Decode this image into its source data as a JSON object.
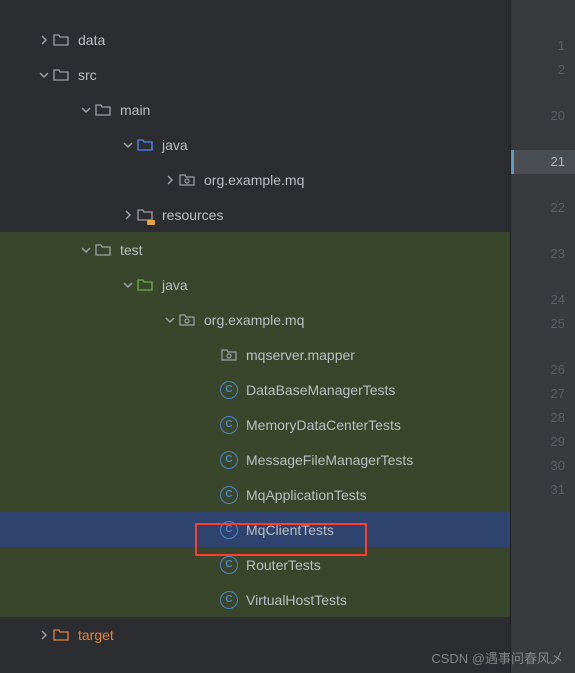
{
  "tree": {
    "data": "data",
    "src": "src",
    "main": "main",
    "main_java": "java",
    "main_pkg": "org.example.mq",
    "resources": "resources",
    "test": "test",
    "test_java": "java",
    "test_pkg": "org.example.mq",
    "pkg_mapper": "mqserver.mapper",
    "c_database": "DataBaseManagerTests",
    "c_memory": "MemoryDataCenterTests",
    "c_message": "MessageFileManagerTests",
    "c_app": "MqApplicationTests",
    "c_client": "MqClientTests",
    "c_router": "RouterTests",
    "c_vhost": "VirtualHostTests",
    "target": "target"
  },
  "gutter": {
    "lines": [
      "1",
      "2",
      "",
      "20",
      "",
      "21",
      "",
      "22",
      "",
      "23",
      "",
      "24",
      "25",
      "",
      "26",
      "27",
      "28",
      "29",
      "30",
      "31"
    ],
    "hlIndex": 5
  },
  "watermark": "CSDN @遇事问春风乄"
}
